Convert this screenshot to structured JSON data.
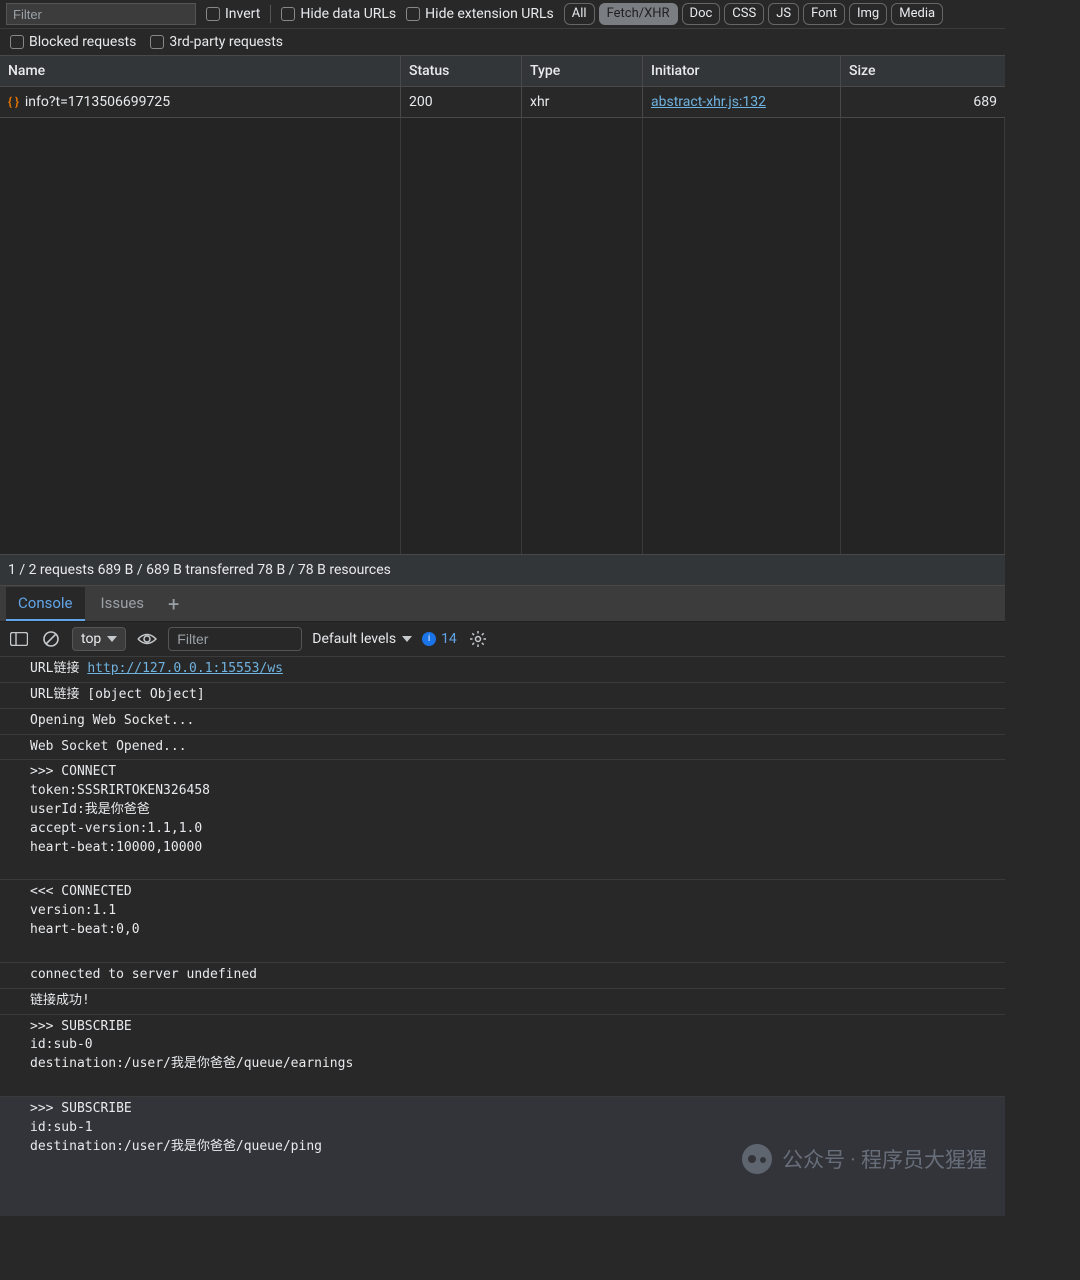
{
  "filterBar": {
    "placeholder": "Filter",
    "invert": "Invert",
    "hideDataUrls": "Hide data URLs",
    "hideExtUrls": "Hide extension URLs",
    "types": [
      "All",
      "Fetch/XHR",
      "Doc",
      "CSS",
      "JS",
      "Font",
      "Img",
      "Media"
    ],
    "activeType": "Fetch/XHR",
    "blocked": "Blocked requests",
    "thirdParty": "3rd-party requests"
  },
  "netHeaders": {
    "name": "Name",
    "status": "Status",
    "type": "Type",
    "initiator": "Initiator",
    "size": "Size"
  },
  "netRows": [
    {
      "name": "info?t=1713506699725",
      "status": "200",
      "type": "xhr",
      "initiator": "abstract-xhr.js:132",
      "size": "689"
    }
  ],
  "netSummary": "1 / 2 requests  689 B / 689 B transferred  78 B / 78 B resources",
  "drawerTabs": {
    "console": "Console",
    "issues": "Issues"
  },
  "consoleToolbar": {
    "context": "top",
    "filterPlaceholder": "Filter",
    "levels": "Default levels",
    "issueCount": "14"
  },
  "log": {
    "l1_prefix": "URL链接 ",
    "l1_link": "http://127.0.0.1:15553/ws",
    "l2": "URL链接 [object Object]",
    "l3": "Opening Web Socket...",
    "l4": "Web Socket Opened...",
    "l5": ">>> CONNECT\ntoken:SSSRIRTOKEN326458\nuserId:我是你爸爸\naccept-version:1.1,1.0\nheart-beat:10000,10000\n\n",
    "l6": "<<< CONNECTED\nversion:1.1\nheart-beat:0,0\n\n",
    "l7": "connected to server undefined",
    "l8": "链接成功!",
    "l9": ">>> SUBSCRIBE\nid:sub-0\ndestination:/user/我是你爸爸/queue/earnings\n\n",
    "l10": ">>> SUBSCRIBE\nid:sub-1\ndestination:/user/我是你爸爸/queue/ping"
  },
  "watermark": "公众号 · 程序员大猩猩"
}
